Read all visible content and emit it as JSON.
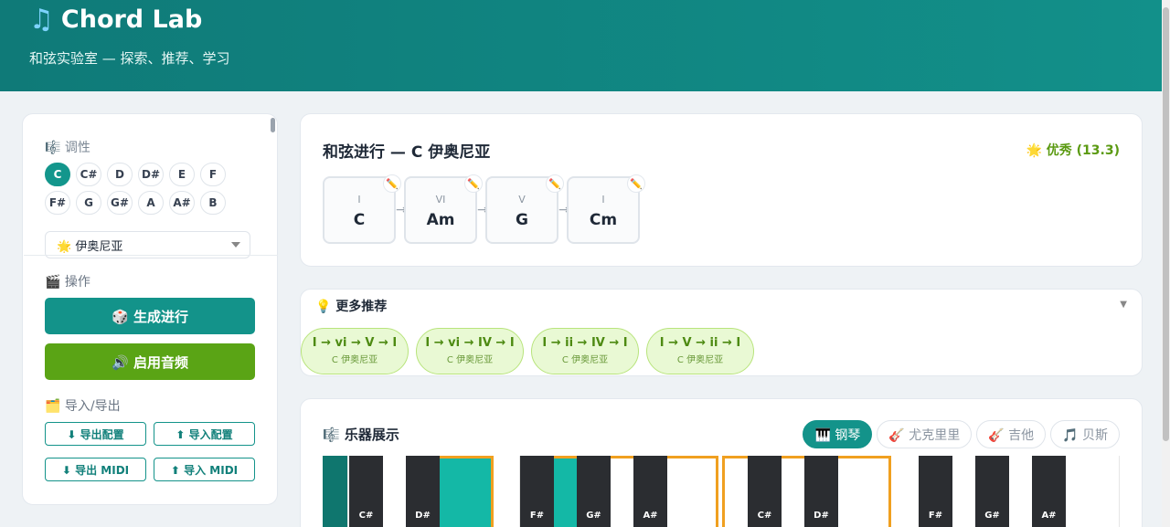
{
  "header": {
    "logo_icon": "music-note-icon",
    "title": "Chord Lab",
    "subtitle": "和弦实验室 — 探索、推荐、学习"
  },
  "sidebar": {
    "key_section_label": "🎼 调性",
    "keys_row1": [
      "C",
      "C#",
      "D",
      "D#",
      "E",
      "F"
    ],
    "keys_row2": [
      "F#",
      "G",
      "G#",
      "A",
      "A#",
      "B"
    ],
    "selected_key": "C",
    "mode_select": "🌟 伊奥尼亚",
    "actions_label": "🎬 操作",
    "generate_button": "🎲 生成进行",
    "audio_button": "🔊 启用音频",
    "io_label": "🗂️ 导入/导出",
    "export_config": "⬇ 导出配置",
    "import_config": "⬆ 导入配置",
    "export_midi": "⬇ 导出 MIDI",
    "import_midi": "⬆ 导入 MIDI"
  },
  "progression": {
    "title": "和弦进行 — C 伊奥尼亚",
    "rating": "🌟 优秀 (13.3)",
    "chords": [
      {
        "roman": "I",
        "name": "C"
      },
      {
        "roman": "VI",
        "name": "Am"
      },
      {
        "roman": "V",
        "name": "G"
      },
      {
        "roman": "I",
        "name": "Cm"
      }
    ],
    "edit_icon": "✏️",
    "arrow": "→"
  },
  "recommendations": {
    "title": "💡 更多推荐",
    "items": [
      {
        "seq": "I → vi → V → I",
        "key": "C 伊奥尼亚"
      },
      {
        "seq": "I → vi → IV → I",
        "key": "C 伊奥尼亚"
      },
      {
        "seq": "I → ii → IV → I",
        "key": "C 伊奥尼亚"
      },
      {
        "seq": "I → V → ii → I",
        "key": "C 伊奥尼亚"
      }
    ]
  },
  "instrument": {
    "title": "🎼 乐器展示",
    "tabs": [
      "🎹 钢琴",
      "🎸 尤克里里",
      "🎸 吉他",
      "🎵 贝斯"
    ],
    "active_tab": 0,
    "black_keys": [
      "C#",
      "D#",
      "F#",
      "G#",
      "A#",
      "C#",
      "D#",
      "F#",
      "G#",
      "A#"
    ]
  }
}
